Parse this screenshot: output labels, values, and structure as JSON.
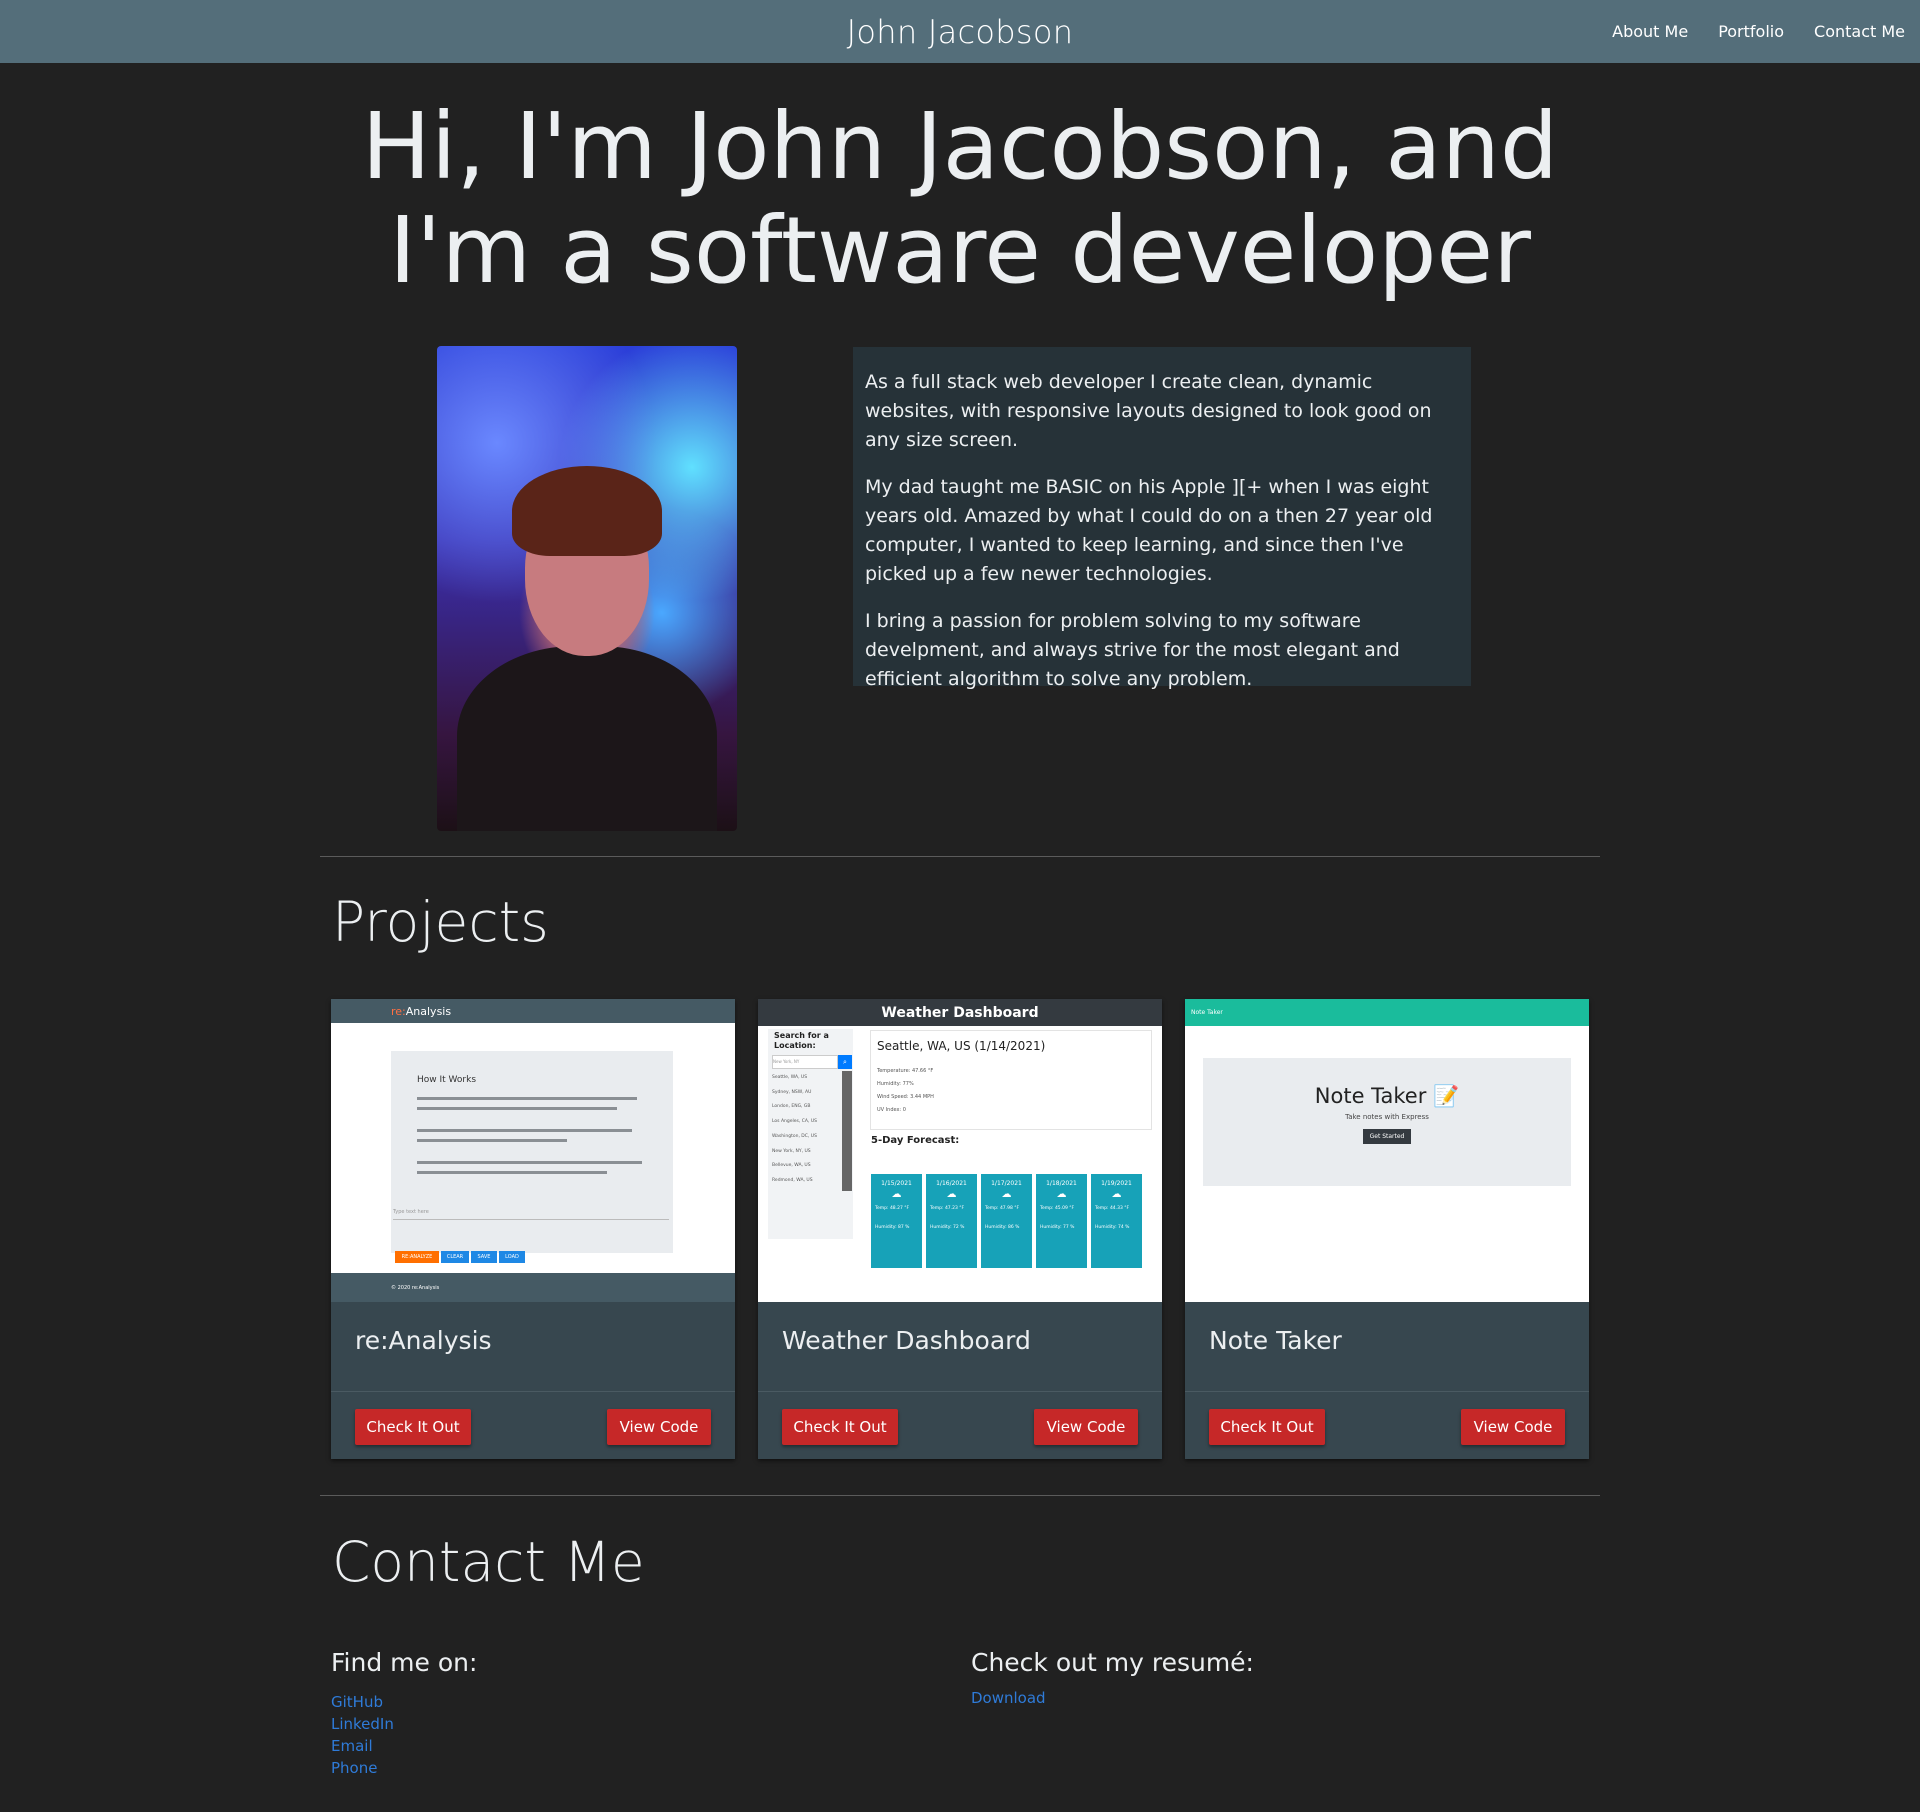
{
  "navbar": {
    "brand": "John Jacobson",
    "links": [
      "About Me",
      "Portfolio",
      "Contact Me"
    ]
  },
  "hero": {
    "line1": "Hi, I'm John Jacobson, and",
    "line2": "I'm a software developer"
  },
  "about": {
    "paragraphs": [
      "As a full stack web developer I create clean, dynamic websites, with responsive layouts designed to look good on any size screen.",
      "My dad taught me BASIC on his Apple ][+ when I was eight years old. Amazed by what I could do on a then 27 year old computer, I wanted to keep learning, and since then I've picked up a few newer technologies.",
      "I bring a passion for problem solving to my software develpment, and always strive for the most elegant and efficient algorithm to solve any problem."
    ]
  },
  "projects": {
    "heading": "Projects",
    "items": [
      {
        "title": "re:Analysis",
        "check_label": "Check It Out",
        "code_label": "View Code",
        "shot": {
          "logo_prefix": "re:",
          "logo_rest": "Analysis",
          "panel_title": "How It Works",
          "input_placeholder": "Type text here",
          "buttons": [
            "RE:ANALYZE",
            "CLEAR",
            "SAVE",
            "LOAD"
          ],
          "footer": "© 2020 re:Analysis"
        }
      },
      {
        "title": "Weather Dashboard",
        "check_label": "Check It Out",
        "code_label": "View Code",
        "shot": {
          "header": "Weather Dashboard",
          "search_label": "Search for a Location:",
          "search_placeholder": "New York, NY",
          "cities": [
            "Seattle, WA, US",
            "Sydney, NSW, AU",
            "London, ENG, GB",
            "Los Angeles, CA, US",
            "Washington, DC, US",
            "New York, NY, US",
            "Bellevue, WA, US",
            "Redmond, WA, US"
          ],
          "current_title": "Seattle, WA, US (1/14/2021)",
          "current_lines": [
            "Temperature: 47.66 °F",
            "Humidity: 77%",
            "Wind Speed: 3.44 MPH",
            "UV Index: 0"
          ],
          "forecast_label": "5-Day Forecast:",
          "days": [
            {
              "date": "1/15/2021",
              "temp": "Temp: 48.27 °F",
              "hum": "Humidity: 87 %"
            },
            {
              "date": "1/16/2021",
              "temp": "Temp: 47.23 °F",
              "hum": "Humidity: 72 %"
            },
            {
              "date": "1/17/2021",
              "temp": "Temp: 47.98 °F",
              "hum": "Humidity: 86 %"
            },
            {
              "date": "1/18/2021",
              "temp": "Temp: 45.09 °F",
              "hum": "Humidity: 77 %"
            },
            {
              "date": "1/19/2021",
              "temp": "Temp: 44.33 °F",
              "hum": "Humidity: 74 %"
            }
          ]
        }
      },
      {
        "title": "Note Taker",
        "check_label": "Check It Out",
        "code_label": "View Code",
        "shot": {
          "header": "Note Taker",
          "jumbo_title": "Note Taker",
          "jumbo_sub": "Take notes with Express",
          "jumbo_button": "Get Started"
        }
      }
    ]
  },
  "contact": {
    "heading": "Contact Me",
    "find_heading": "Find me on:",
    "links": [
      "GitHub",
      "LinkedIn",
      "Email",
      "Phone"
    ],
    "resume_heading": "Check out my resumé:",
    "resume_link": "Download"
  },
  "colors": {
    "navbar": "#546e7a",
    "background": "#212121",
    "card": "#37474f",
    "about_box": "#263238",
    "button": "#c62828",
    "link": "#2f7bd8"
  }
}
